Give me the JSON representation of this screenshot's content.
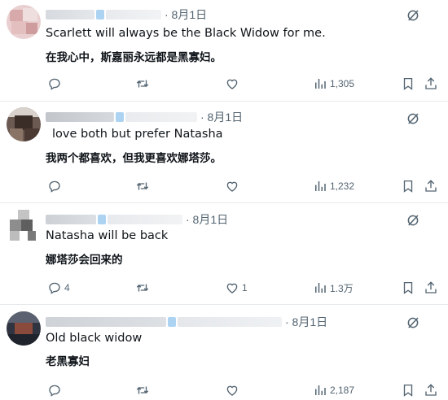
{
  "posts": [
    {
      "date": "· 8月1日",
      "text_en": "Scarlett will always be the Black Widow for me.",
      "text_zh": "在我心中，斯嘉丽永远都是黑寡妇。",
      "reply_count": "",
      "like_count": "",
      "views": "1,305"
    },
    {
      "date": "· 8月1日",
      "text_en": "love both but prefer Natasha",
      "text_zh": "我两个都喜欢，但我更喜欢娜塔莎。",
      "reply_count": "",
      "like_count": "",
      "views": "1,232"
    },
    {
      "date": "· 8月1日",
      "text_en": "Natasha will be back",
      "text_zh": "娜塔莎会回来的",
      "reply_count": "4",
      "like_count": "1",
      "views": "1.3万"
    },
    {
      "date": "· 8月1日",
      "text_en": "Old black widow",
      "text_zh": "老黑寡妇",
      "reply_count": "",
      "like_count": "",
      "views": "2,187"
    }
  ],
  "icons": [
    "grok-icon",
    "reply-icon",
    "repost-icon",
    "like-icon",
    "views-icon",
    "bookmark-icon",
    "share-icon"
  ],
  "colors": {
    "text": "#0f1419",
    "muted": "#536471",
    "separator": "#e6e9ec",
    "blur_blue": "#9ecbf0"
  }
}
